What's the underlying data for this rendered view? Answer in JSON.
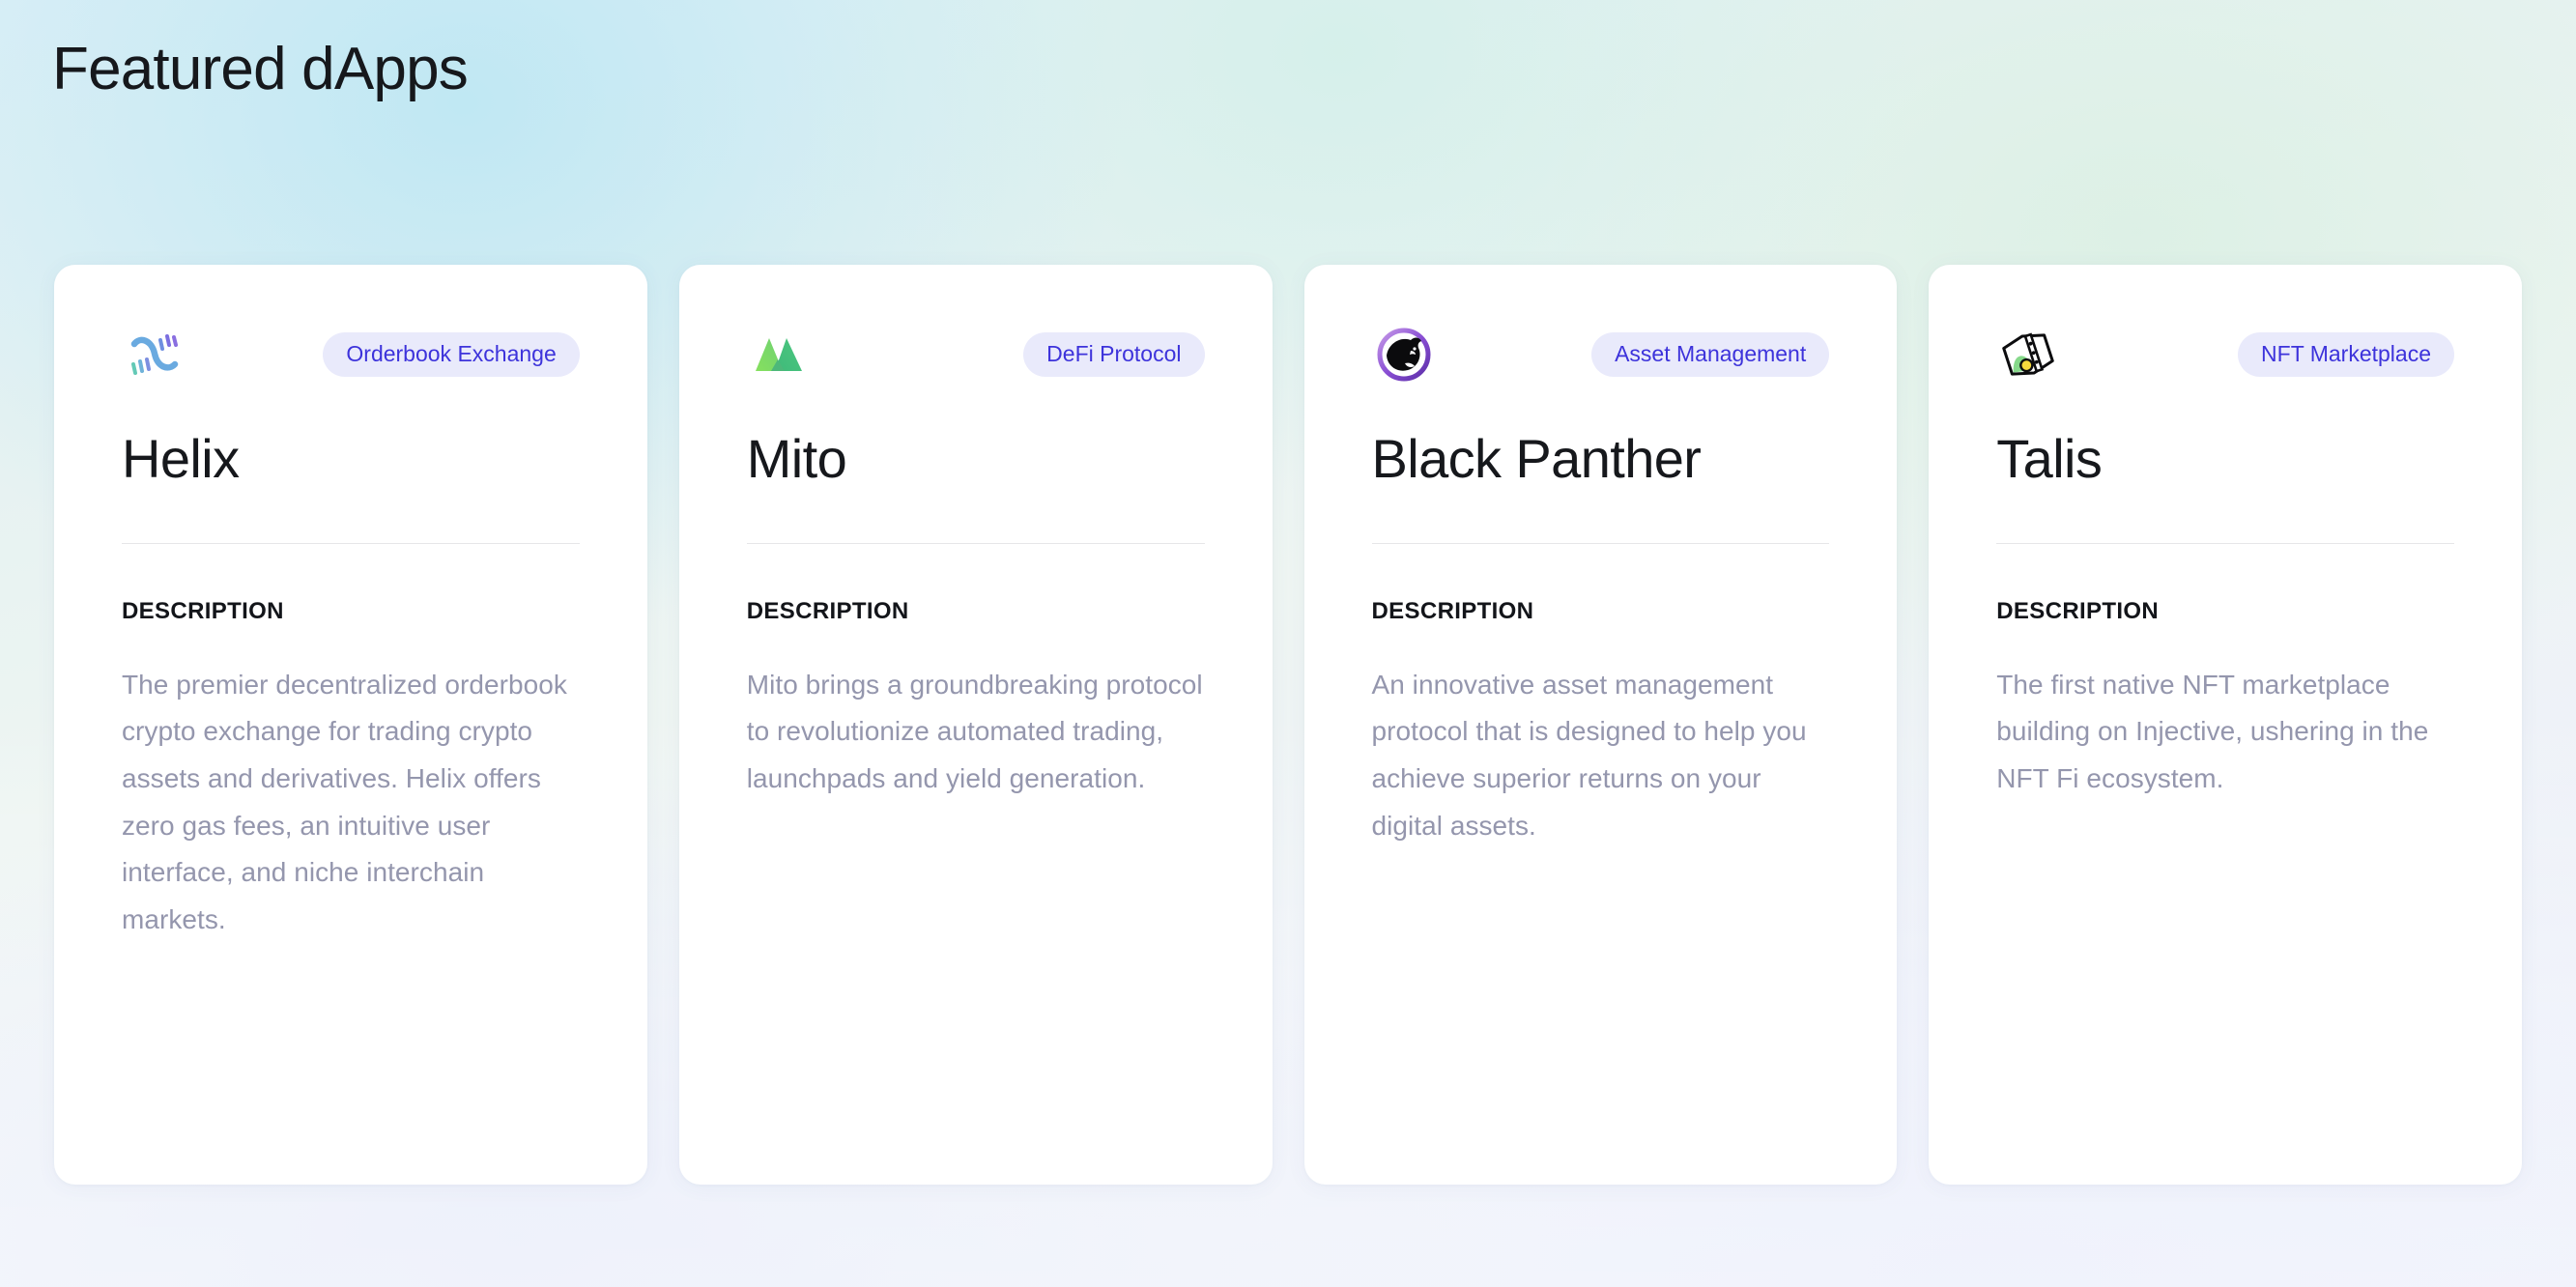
{
  "header": {
    "title": "Featured dApps"
  },
  "labels": {
    "description": "DESCRIPTION"
  },
  "colors": {
    "badge_bg": "#e9eafb",
    "badge_text": "#3d33db",
    "title_text": "#16181c",
    "body_text": "#9496ad",
    "card_bg": "#ffffff",
    "divider": "#e6e6e8"
  },
  "cards": [
    {
      "icon": "helix-logo-icon",
      "name": "Helix",
      "badge": "Orderbook Exchange",
      "description_label": "DESCRIPTION",
      "description": "The premier decentralized orderbook crypto exchange for trading crypto assets and derivatives. Helix offers zero gas fees, an intuitive user interface, and niche interchain markets."
    },
    {
      "icon": "mito-logo-icon",
      "name": "Mito",
      "badge": "DeFi Protocol",
      "description_label": "DESCRIPTION",
      "description": "Mito brings a groundbreaking protocol to revolutionize automated trading, launchpads and yield generation."
    },
    {
      "icon": "black-panther-logo-icon",
      "name": "Black Panther",
      "badge": "Asset Management",
      "description_label": "DESCRIPTION",
      "description": "An innovative asset management protocol that is designed to help you achieve superior returns on your digital assets."
    },
    {
      "icon": "talis-logo-icon",
      "name": "Talis",
      "badge": "NFT Marketplace",
      "description_label": "DESCRIPTION",
      "description": "The first native NFT marketplace building on Injective, ushering in the NFT Fi ecosystem."
    }
  ]
}
